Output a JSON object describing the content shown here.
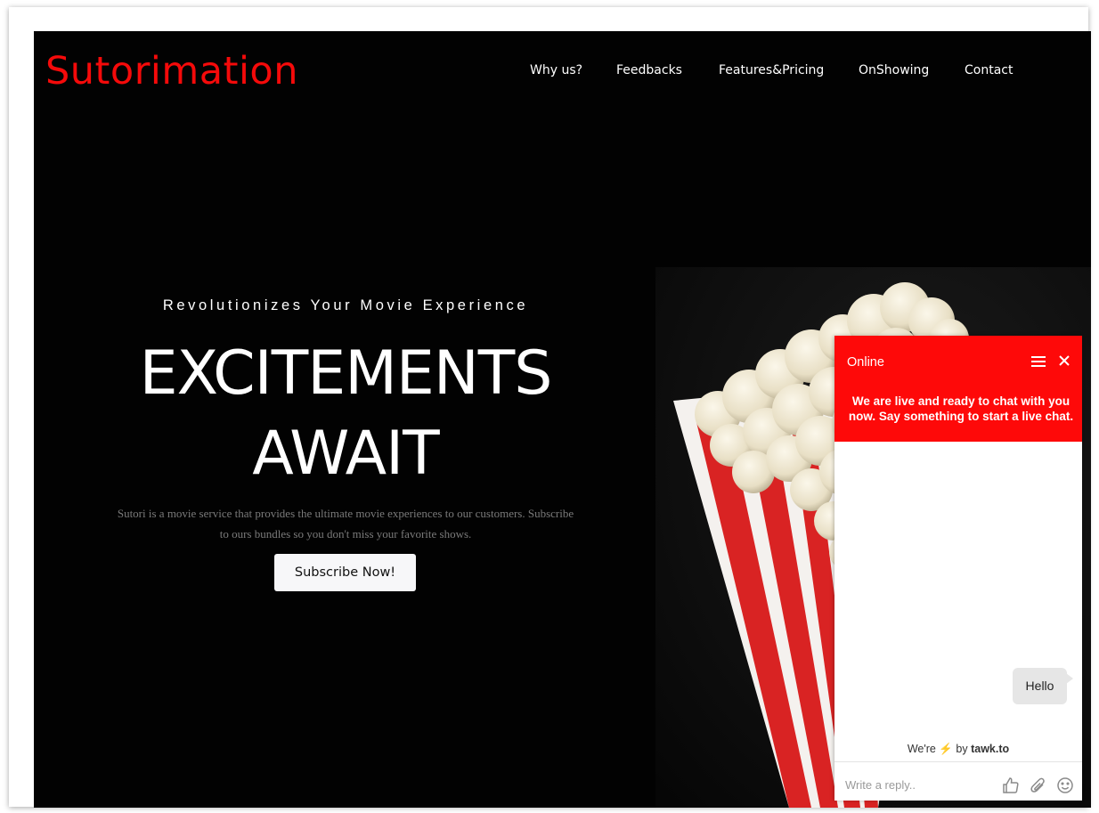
{
  "brand": {
    "name": "Sutorimation",
    "color": "#f50a0a"
  },
  "nav": {
    "items": [
      {
        "label": "Why us?"
      },
      {
        "label": "Feedbacks"
      },
      {
        "label": "Features&Pricing"
      },
      {
        "label": "OnShowing"
      },
      {
        "label": "Contact"
      }
    ]
  },
  "hero": {
    "subtitle": "Revolutionizes Your Movie Experience",
    "title_line1": "EXCITEMENTS",
    "title_line2": "AWAIT",
    "description_line1": "Sutori is a movie service that provides the ultimate movie experiences to our customers. Subscribe",
    "description_line2": "to ours bundles so you don't miss your favorite shows.",
    "cta_label": "Subscribe Now!",
    "image_icon": "popcorn-image"
  },
  "chat": {
    "status": "Online",
    "header_color": "#fe0909",
    "intro": "We are live and ready to chat with you now. Say something to start a live chat.",
    "messages": [
      {
        "text": "Hello",
        "from": "visitor"
      }
    ],
    "branding_prefix": "We're",
    "branding_bolt": "⚡",
    "branding_suffix": "by",
    "branding_name": "tawk.to",
    "input_placeholder": "Write a reply..",
    "icons": [
      "menu-icon",
      "close-icon",
      "thumbs-up-icon",
      "attachment-icon",
      "emoji-icon"
    ]
  }
}
